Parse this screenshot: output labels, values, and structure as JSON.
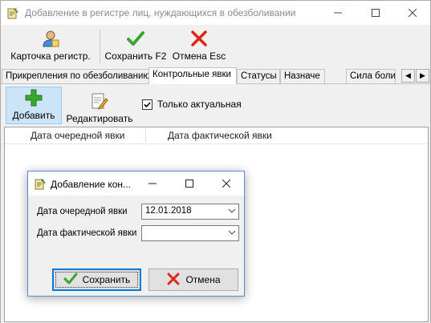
{
  "window": {
    "title": "Добавление в регистре лиц, нуждающихся в обезболивании",
    "minimize_icon": "minimize-icon",
    "maximize_icon": "maximize-icon",
    "close_icon": "close-icon"
  },
  "toolbar": {
    "card_label": "Карточка регистр.",
    "save_label": "Сохранить F2",
    "cancel_label": "Отмена Esc"
  },
  "tabs": [
    {
      "label": "Прикрепления по обезболиванию"
    },
    {
      "label": "Контрольные явки"
    },
    {
      "label": "Статусы"
    },
    {
      "label": "Назначе"
    },
    {
      "label": "Сила боли"
    }
  ],
  "tab_scroll": {
    "left": "◀",
    "right": "▶"
  },
  "page_toolbar": {
    "add_label": "Добавить",
    "edit_label": "Редактировать",
    "only_actual_label": "Только актуальная",
    "only_actual_checked": true
  },
  "grid": {
    "columns": [
      "Дата очередной явки",
      "Дата фактической явки"
    ]
  },
  "dialog": {
    "title": "Добавление кон...",
    "fields": [
      {
        "label": "Дата очередной явки",
        "value": "12.01.2018"
      },
      {
        "label": "Дата фактической явки",
        "value": ""
      }
    ],
    "ok_label": "Сохранить",
    "cancel_label": "Отмена"
  },
  "colors": {
    "accent": "#0078d7",
    "green_check": "#3aa530",
    "red_x": "#e0261b",
    "selected_button": "#cce4f7"
  }
}
